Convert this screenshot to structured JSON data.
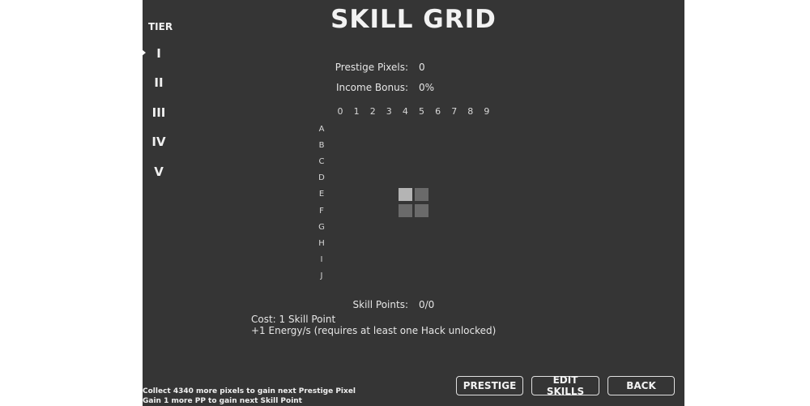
{
  "title": "SKILL GRID",
  "tiers": {
    "label": "TIER",
    "items": [
      "I",
      "II",
      "III",
      "IV",
      "V"
    ],
    "selected": "I"
  },
  "stats": {
    "prestige_pixels_label": "Prestige Pixels:",
    "prestige_pixels_value": "0",
    "income_bonus_label": "Income Bonus:",
    "income_bonus_value": "0%",
    "skill_points_label": "Skill Points:",
    "skill_points_value": "0/0"
  },
  "grid": {
    "columns": [
      "0",
      "1",
      "2",
      "3",
      "4",
      "5",
      "6",
      "7",
      "8",
      "9"
    ],
    "rows": [
      "A",
      "B",
      "C",
      "D",
      "E",
      "F",
      "G",
      "H",
      "I",
      "J"
    ],
    "cells": [
      {
        "id": "E4",
        "row": "E",
        "col": "4",
        "state": "selected",
        "color": "#b4b4b4"
      },
      {
        "id": "E5",
        "row": "E",
        "col": "5",
        "state": "locked",
        "color": "#6a6a6a"
      },
      {
        "id": "F4",
        "row": "F",
        "col": "4",
        "state": "locked",
        "color": "#6a6a6a"
      },
      {
        "id": "F5",
        "row": "F",
        "col": "5",
        "state": "locked",
        "color": "#6a6a6a"
      }
    ]
  },
  "skill_info": {
    "cost": "Cost: 1 Skill Point",
    "effect": "+1 Energy/s (requires at least one Hack unlocked)"
  },
  "buttons": {
    "prestige": "PRESTIGE",
    "edit_skills": "EDIT SKILLS",
    "back": "BACK"
  },
  "footer": {
    "line1": "Collect 4340 more pixels to gain next Prestige Pixel",
    "line2": "Gain 1 more PP to gain next Skill Point"
  },
  "colors": {
    "background": "#353535",
    "text": "#e6e6e6",
    "cell_selected": "#b4b4b4",
    "cell_locked": "#6a6a6a"
  }
}
